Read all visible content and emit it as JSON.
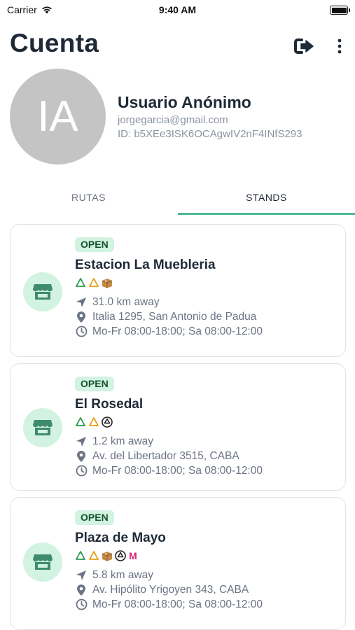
{
  "status_bar": {
    "carrier": "Carrier",
    "time": "9:40 AM"
  },
  "header": {
    "title": "Cuenta"
  },
  "profile": {
    "initials": "IA",
    "name": "Usuario Anónimo",
    "email": "jorgegarcia@gmail.com",
    "id": "ID: b5XEe3ISK6OCAgwIV2nF4INfS293"
  },
  "tabs": [
    {
      "label": "RUTAS",
      "active": false
    },
    {
      "label": "STANDS",
      "active": true
    }
  ],
  "accent_color": "#4cb89a",
  "stands": [
    {
      "status": "OPEN",
      "name": "Estacion La Muebleria",
      "materials": [
        "recycle-green-icon",
        "recycle-yellow-icon",
        "cardboard-box-icon"
      ],
      "distance": "31.0 km away",
      "address": "Italia 1295, San Antonio de Padua",
      "hours": "Mo-Fr 08:00-18:00; Sa 08:00-12:00"
    },
    {
      "status": "OPEN",
      "name": "El Rosedal",
      "materials": [
        "recycle-green-icon",
        "recycle-yellow-icon",
        "recycle-black-icon"
      ],
      "distance": "1.2 km away",
      "address": "Av. del Libertador 3515, CABA",
      "hours": "Mo-Fr 08:00-18:00; Sa 08:00-12:00"
    },
    {
      "status": "OPEN",
      "name": "Plaza de Mayo",
      "materials": [
        "recycle-green-icon",
        "recycle-yellow-icon",
        "cardboard-box-icon",
        "recycle-black-icon",
        "metal-m-icon"
      ],
      "metal_label": "M",
      "distance": "5.8 km away",
      "address": "Av. Hipólito Yrigoyen 343, CABA",
      "hours": "Mo-Fr 08:00-18:00; Sa 08:00-12:00"
    }
  ]
}
